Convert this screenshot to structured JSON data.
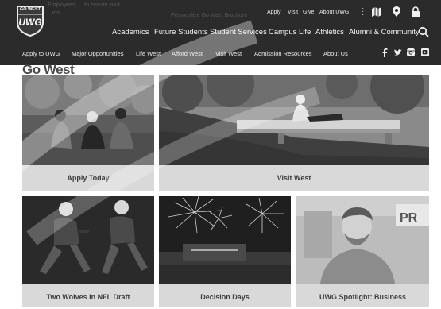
{
  "ghost": {
    "line1": "Employees, ... to ensure your",
    "line2": "...ion",
    "line3": "Personalize Go West Brochure"
  },
  "logo": {
    "top": "GO WEST",
    "main": "UWG"
  },
  "utility_nav": {
    "apply": "Apply",
    "visit": "Visit",
    "give": "Give",
    "about": "About UWG"
  },
  "main_nav": [
    "Academics",
    "Future Students",
    "Student Services",
    "Campus Life",
    "Athletics",
    "Alumni & Community"
  ],
  "sub_nav": [
    "Apply to UWG",
    "Major Opportunities",
    "Life West",
    "Afford West",
    "Visit West",
    "Admission Resources",
    "About Us"
  ],
  "page_title": "Go West",
  "cards": [
    {
      "caption": "Apply Today"
    },
    {
      "caption": "Visit West"
    },
    {
      "caption": "Two Wolves in NFL Draft"
    },
    {
      "caption": "Decision Days"
    },
    {
      "caption": "UWG Spotlight: Business"
    }
  ],
  "icons": [
    "map-book-icon",
    "location-pin-icon",
    "lock-icon",
    "search-icon",
    "facebook-icon",
    "twitter-icon",
    "instagram-icon",
    "youtube-icon"
  ]
}
